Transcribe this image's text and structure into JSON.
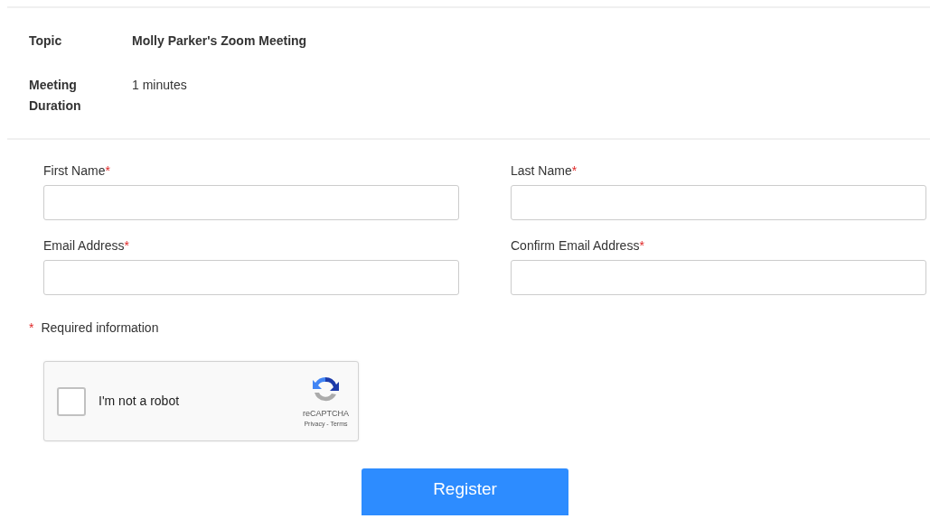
{
  "details": [
    {
      "label": "Topic",
      "value": "Molly Parker's Zoom Meeting"
    },
    {
      "label": "Meeting Duration",
      "value": "1 minutes"
    }
  ],
  "required_mark": "*",
  "fields": [
    {
      "label": "First Name",
      "required": true
    },
    {
      "label": "Last Name",
      "required": true
    },
    {
      "label": "Email Address",
      "required": true
    },
    {
      "label": "Confirm Email Address",
      "required": true
    }
  ],
  "required_note": "Required information",
  "captcha": {
    "checked": false,
    "label": "I'm not a robot",
    "brand": "reCAPTCHA",
    "links": "Privacy - Terms"
  },
  "submit": "Register"
}
